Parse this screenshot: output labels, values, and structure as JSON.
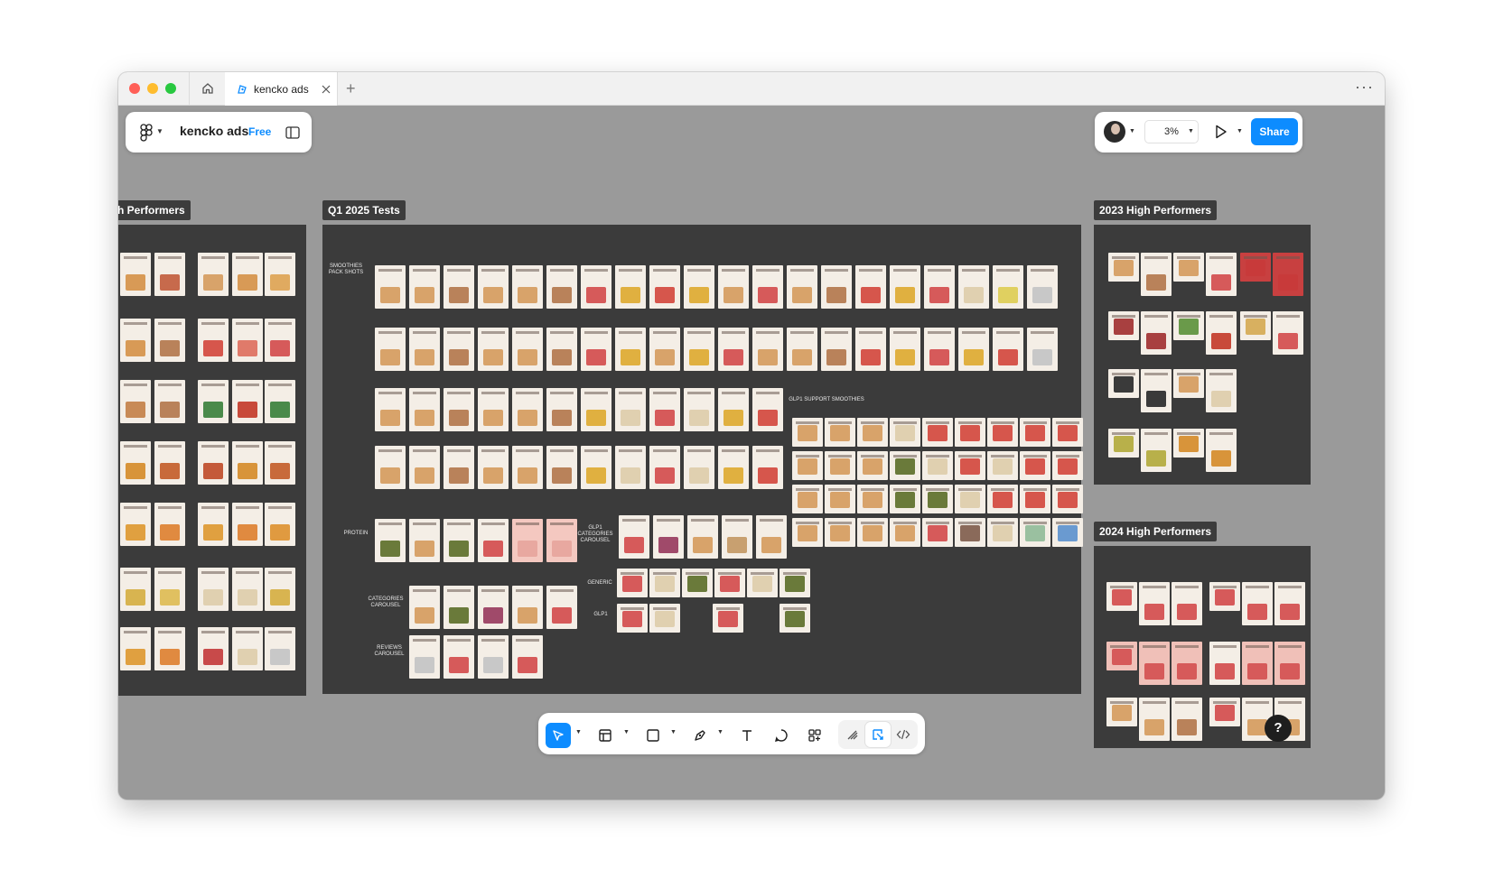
{
  "browser": {
    "tab_title": "kencko ads",
    "new_tab": "+",
    "more": "···"
  },
  "toolbar_left": {
    "file_name": "kencko ads",
    "plan_badge": "Free"
  },
  "toolbar_right": {
    "zoom": "3%",
    "share_label": "Share"
  },
  "canvas": {
    "frames": [
      {
        "label": "h Performers"
      },
      {
        "label": "Q1 2025 Tests"
      },
      {
        "label": "2023 High Performers"
      },
      {
        "label": "2024 High Performers"
      }
    ],
    "sections": [
      "SMOOTHIES PACK SHOTS",
      "PROTEIN",
      "GLP1 CATEGORIES CAROUSEL",
      "CATEGORIES CAROUSEL",
      "REVIEWS CAROUSEL",
      "GLP1 SUPPORT SMOOTHIES",
      "GENERIC",
      "GLP1"
    ]
  },
  "tools": [
    "move-tool",
    "frame-tool",
    "shape-tool",
    "pen-tool",
    "text-tool",
    "comment-tool",
    "actions-tool",
    "draw-mode",
    "design-mode",
    "dev-mode"
  ],
  "help": "?"
}
